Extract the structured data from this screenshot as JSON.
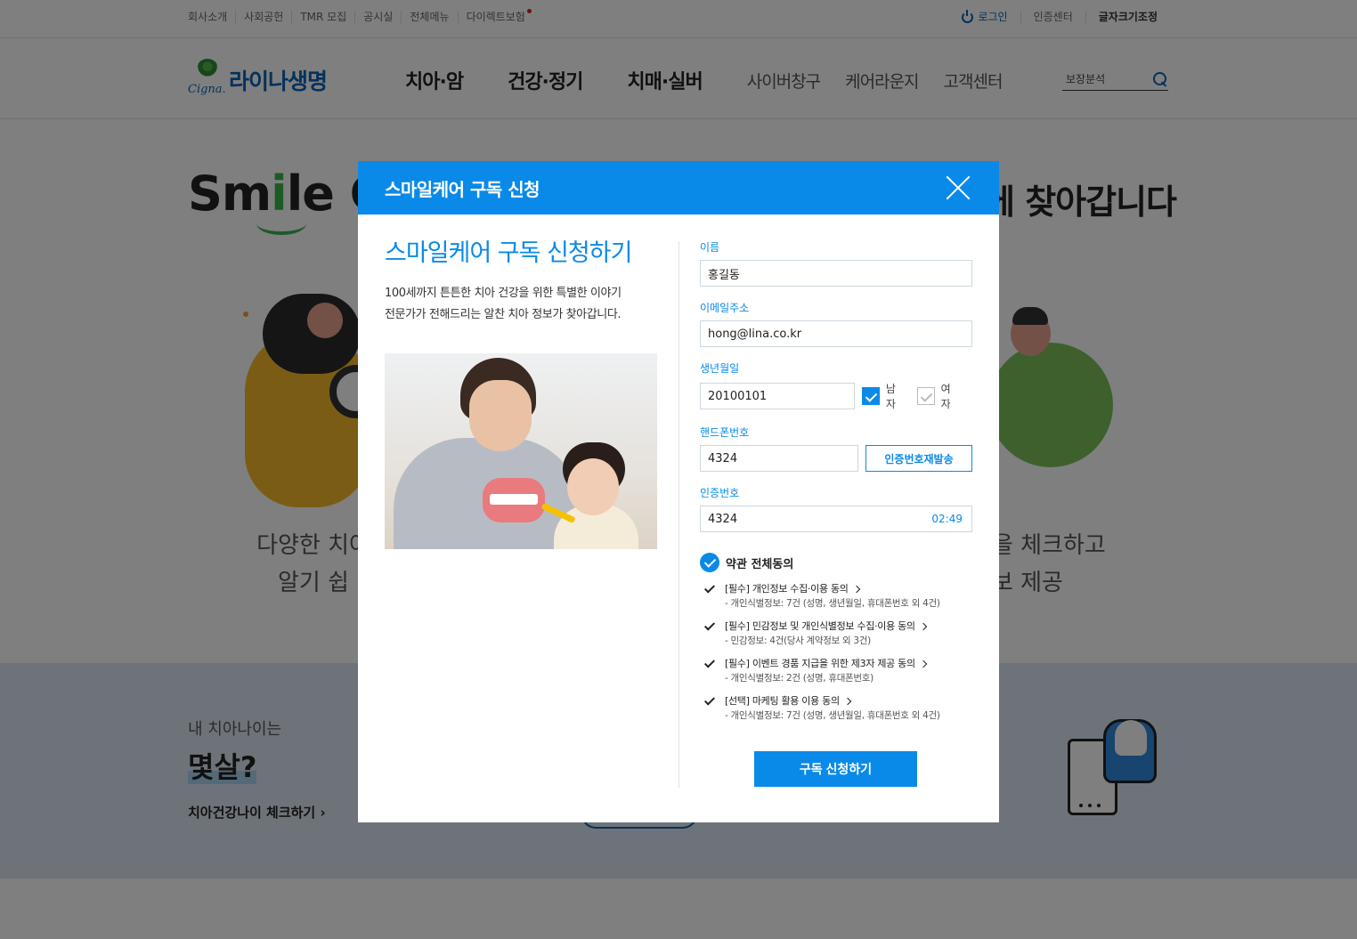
{
  "util": {
    "left": [
      "회사소개",
      "사회공헌",
      "TMR 모집",
      "공시실",
      "전체메뉴",
      "다이렉트보험"
    ],
    "login": "로그인",
    "cert": "인증센터",
    "fontsize": "글자크기조정"
  },
  "gnb": {
    "logo_sub": "Cigna.",
    "logo_text": "라이나생명",
    "main": [
      "치아·암",
      "건강·정기",
      "치매·실버"
    ],
    "sub": [
      "사이버창구",
      "케어라운지",
      "고객센터"
    ],
    "search_placeholder": "보장분석"
  },
  "hero": {
    "title_a": "Sm",
    "title_i": "i",
    "title_b": "le C",
    "title_right": "에 찾아갑니다",
    "desc_left_1": "다양한 치아 ",
    "desc_left_2": "알기 쉽",
    "desc_right_1": "상을 체크하고",
    "desc_right_2": "정보 제공"
  },
  "band": {
    "t1": "내 치아나이는",
    "t2": "몇살?",
    "t3": "치아건강나이 체크하기 ›"
  },
  "modal": {
    "title": "스마일케어 구독 신청",
    "heading": "스마일케어 구독 신청하기",
    "desc1": "100세까지 튼튼한 치아 건강을 위한 특별한 이야기",
    "desc2": "전문가가 전해드리는 알찬 치아 정보가 찾아갑니다.",
    "name_label": "이름",
    "name_value": "홍길동",
    "email_label": "이메일주소",
    "email_value": "hong@lina.co.kr",
    "birth_label": "생년월일",
    "birth_value": "20100101",
    "gender_male": "남자",
    "gender_female": "여자",
    "phone_label": "핸드폰번호",
    "phone_value": "4324",
    "resend": "인증번호재발송",
    "code_label": "인증번호",
    "code_value": "4324",
    "timer": "02:49",
    "agree_all": "약관 전체동의",
    "terms": [
      {
        "title": "[필수] 개인정보 수집·이용 동의",
        "sub": "- 개인식별정보: 7건 (성명, 생년월일, 휴대폰번호 외 4건)"
      },
      {
        "title": "[필수] 민감정보 및 개인식별정보 수집·이용 동의",
        "sub": "- 민감정보: 4건(당사 계약정보 외 3건)"
      },
      {
        "title": "[필수] 이벤트 경품 지급을 위한 제3자 제공 동의",
        "sub": "- 개인식별정보: 2건 (성명, 휴대폰번호)"
      },
      {
        "title": "[선택] 마케팅 활용 이용 동의",
        "sub": "- 개인식별정보: 7건 (성명, 생년월일, 휴대폰번호 외 4건)"
      }
    ],
    "submit": "구독 신청하기"
  }
}
